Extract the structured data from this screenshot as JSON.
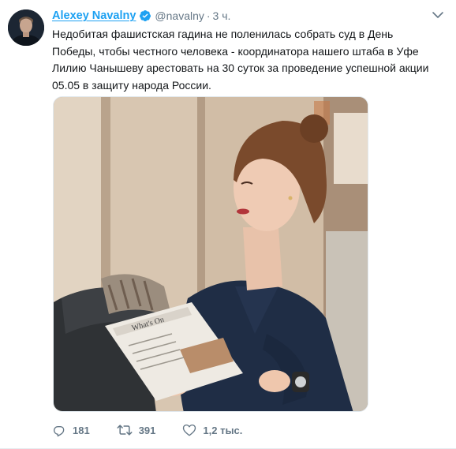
{
  "author": {
    "name": "Alexey Navalny",
    "handle": "@navalny",
    "separator": "·",
    "time": "3 ч."
  },
  "tweet": {
    "text": "Недобитая фашистская гадина не поленилась собрать суд в День Победы, чтобы честного человека - координатора нашего штаба в Уфе Лилию Чанышеву арестовать на 30 суток за проведение успешной акции 05.05 в защиту народа России."
  },
  "media": {
    "newspaper_heading": "What's On"
  },
  "actions": {
    "replies": "181",
    "retweets": "391",
    "likes": "1,2 тыс."
  },
  "icons": {
    "verified": "verified-badge-icon",
    "menu": "chevron-down-icon",
    "reply": "reply-icon",
    "retweet": "retweet-icon",
    "like": "heart-icon"
  },
  "colors": {
    "accent": "#1da1f2",
    "muted": "#657786",
    "text": "#14171a"
  }
}
